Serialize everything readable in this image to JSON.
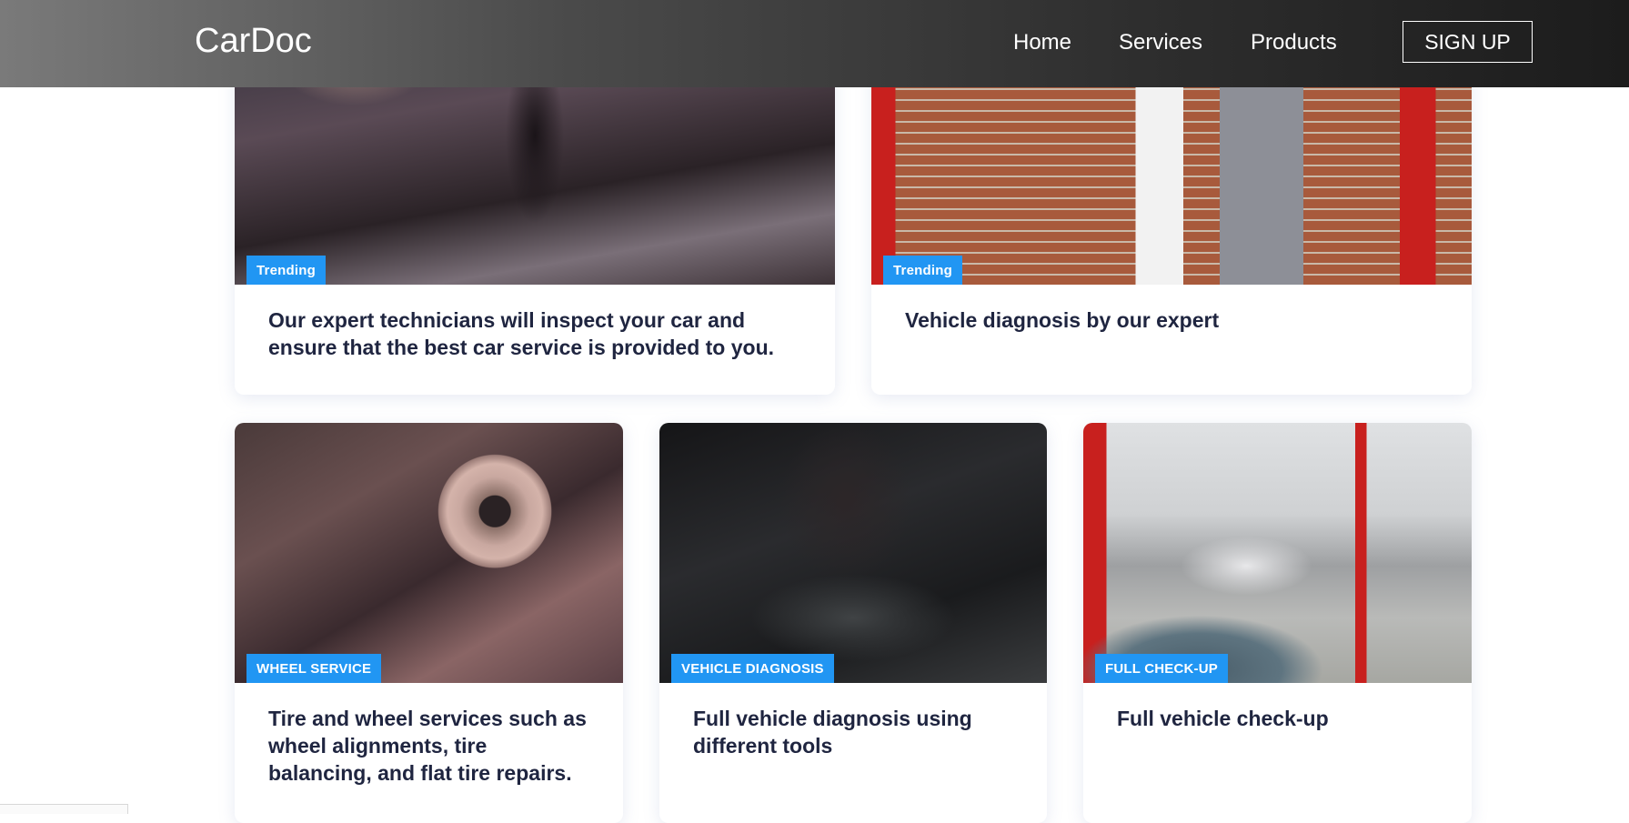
{
  "navbar": {
    "logo": "CarDoc",
    "links": [
      {
        "label": "Home"
      },
      {
        "label": "Services"
      },
      {
        "label": "Products"
      }
    ],
    "signup_label": "SIGN UP"
  },
  "cards": [
    {
      "badge": "Trending",
      "text": "Our expert technicians will inspect your car and ensure that the best car service is provided to you."
    },
    {
      "badge": "Trending",
      "text": "Vehicle diagnosis by our expert"
    },
    {
      "badge": "WHEEL SERVICE",
      "text": "Tire and wheel services such as wheel alignments, tire balancing, and flat tire repairs."
    },
    {
      "badge": "VEHICLE DIAGNOSIS",
      "text": "Full vehicle diagnosis using different tools"
    },
    {
      "badge": "FULL CHECK-UP",
      "text": "Full vehicle check-up"
    }
  ],
  "colors": {
    "badge": "#2196f3",
    "card_text": "#1f2540",
    "nav_text": "#ffffff"
  }
}
